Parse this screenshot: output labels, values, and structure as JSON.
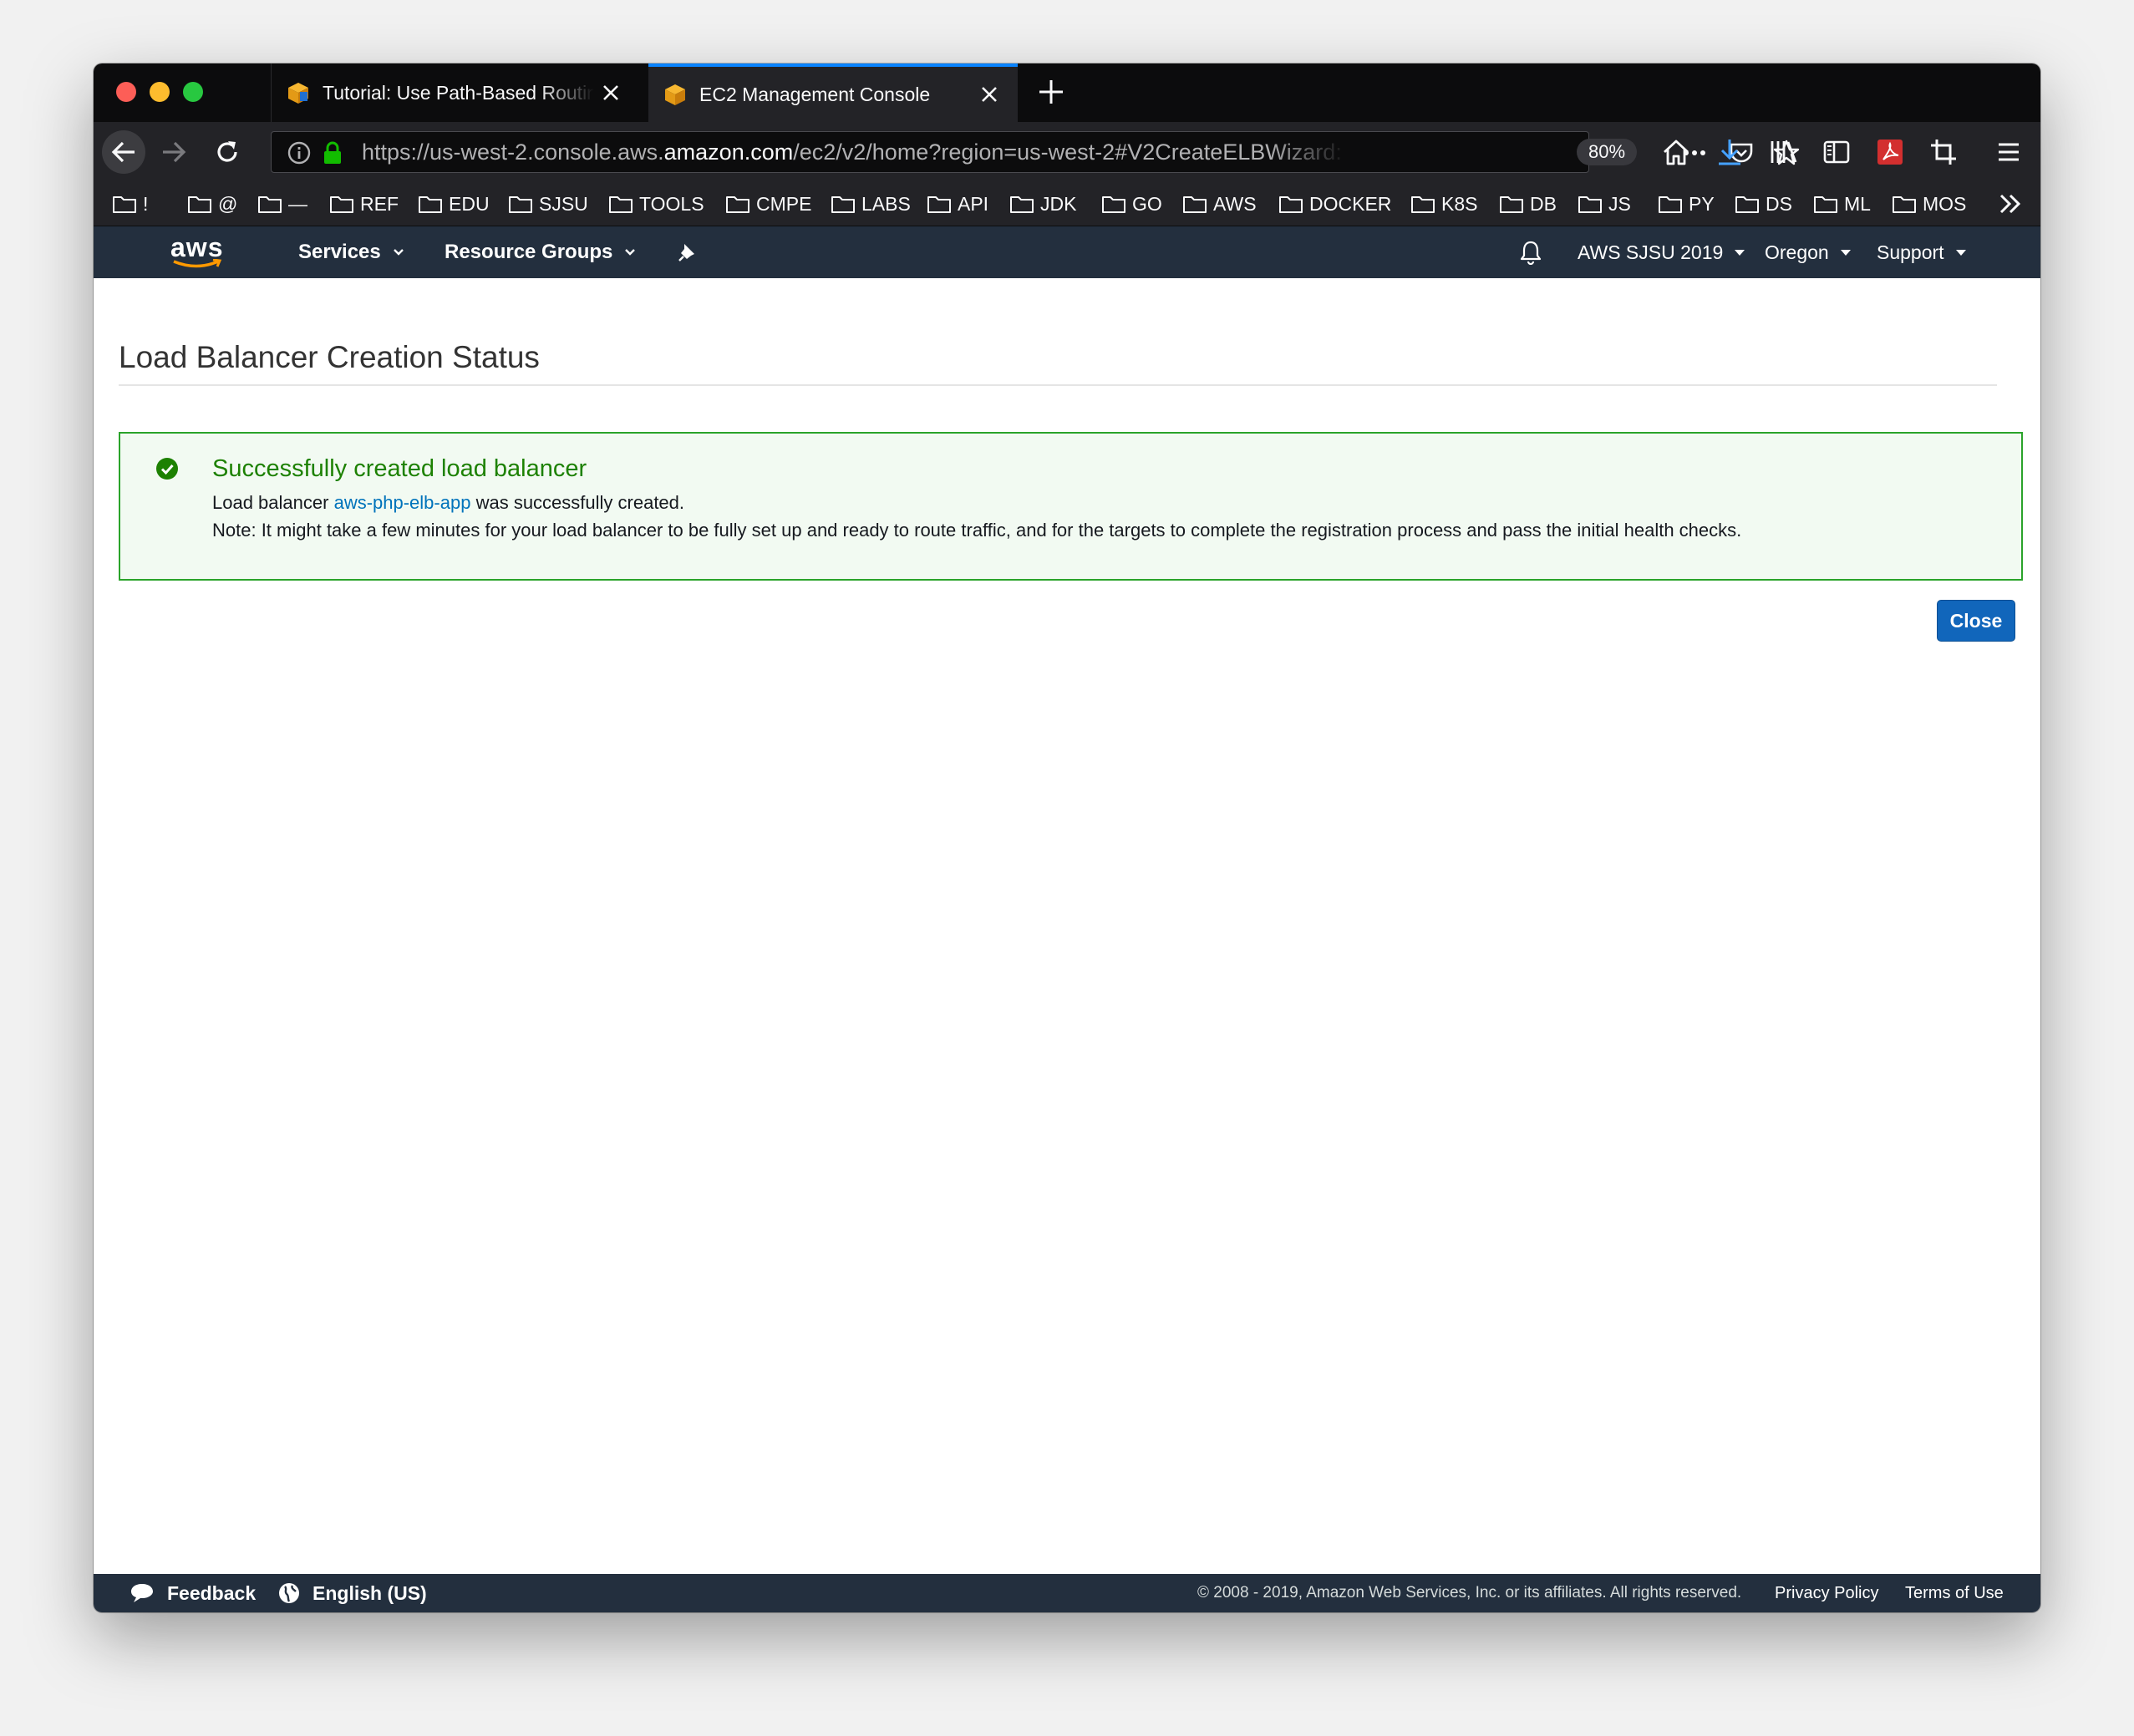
{
  "browser": {
    "tabs": [
      {
        "title": "Tutorial: Use Path-Based Routing with Your Application Load Balancer",
        "active": false
      },
      {
        "title": "EC2 Management Console",
        "active": true
      }
    ],
    "url_prefix": "https://us-west-2.console.aws.",
    "url_host": "amazon.com",
    "url_path": "/ec2/v2/home?region=us-west-2#V2CreateELBWizard:",
    "zoom": "80%",
    "bookmarks": [
      "!",
      "@",
      "—",
      "REF",
      "EDU",
      "SJSU",
      "TOOLS",
      "CMPE",
      "LABS",
      "API",
      "JDK",
      "GO",
      "AWS",
      "DOCKER",
      "K8S",
      "DB",
      "JS",
      "PY",
      "DS",
      "ML",
      "MOS"
    ]
  },
  "aws_header": {
    "logo": "aws",
    "services": "Services",
    "resource_groups": "Resource Groups",
    "account": "AWS SJSU 2019",
    "region": "Oregon",
    "support": "Support"
  },
  "page": {
    "title": "Load Balancer Creation Status",
    "alert": {
      "heading": "Successfully created load balancer",
      "line1_prefix": "Load balancer",
      "lb_name": "aws-php-elb-app",
      "line1_suffix": "was successfully created.",
      "note": "Note: It might take a few minutes for your load balancer to be fully set up and ready to route traffic, and for the targets to complete the registration process and pass the initial health checks."
    },
    "close_label": "Close"
  },
  "footer": {
    "feedback": "Feedback",
    "language": "English (US)",
    "copyright": "© 2008 - 2019, Amazon Web Services, Inc. or its affiliates. All rights reserved.",
    "privacy": "Privacy Policy",
    "terms": "Terms of Use"
  },
  "colors": {
    "aws_nav": "#232f3e",
    "success_green": "#1d8102",
    "link_blue": "#0073bb",
    "primary_button": "#1166bb"
  }
}
